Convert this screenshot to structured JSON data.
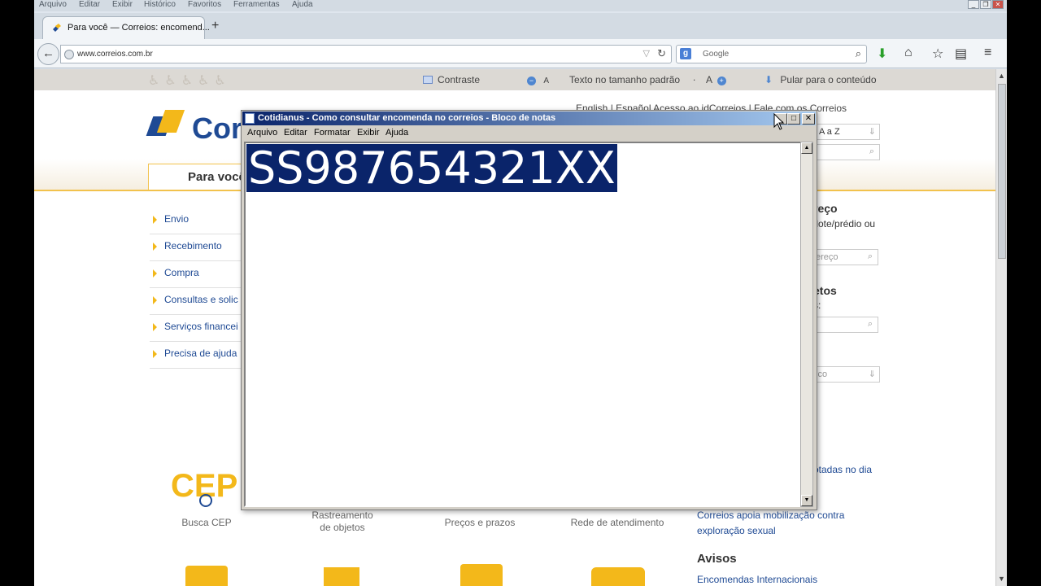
{
  "browser": {
    "menu": [
      "Arquivo",
      "Editar",
      "Exibir",
      "Histórico",
      "Favoritos",
      "Ferramentas",
      "Ajuda"
    ],
    "tab_title": "Para você — Correios: encomend...",
    "new_tab": "+",
    "url": "www.correios.com.br",
    "search_placeholder": "Google",
    "search_engine_letter": "g",
    "back_glyph": "←",
    "icons": [
      "download-icon",
      "home-icon",
      "bookmark-star-icon",
      "reader-icon",
      "menu-icon"
    ]
  },
  "site": {
    "topbar": {
      "contrast": "Contraste",
      "font_minus": "A",
      "font_default": "Texto no tamanho padrão",
      "font_plus": "A",
      "skip": "Pular para o conteúdo"
    },
    "langs": "English  |  Español      Acesso ao idCorreios  |  Fale com os Correios",
    "logo_text": "Cor",
    "tab_active": "Para você",
    "left_menu": [
      "Envio",
      "Recebimento",
      "Compra",
      "Consultas e solic",
      "Serviços financei",
      "Precisa de ajuda"
    ],
    "right": {
      "az": "A a Z",
      "endereco_title": "reço",
      "endereco_text": "/lote/prédio ou",
      "endereco_input": "ereço",
      "objetos_title": "etos",
      "objetos_text": "s:",
      "servico_input": "ico",
      "news1": "otadas no dia",
      "news2": "Correios apoia mobilização contra exploração sexual",
      "avisos_title": "Avisos",
      "avisos_link": "Encomendas Internacionais"
    },
    "bottom": {
      "cep_big": "CEP",
      "busca_cep": "Busca CEP",
      "rastreamento": "Rastreamento\nde objetos",
      "precos": "Preços e prazos",
      "rede": "Rede de atendimento"
    }
  },
  "notepad": {
    "title": "Cotidianus - Como consultar encomenda no correios - Bloco de notas",
    "menu": [
      "Arquivo",
      "Editar",
      "Formatar",
      "Exibir",
      "Ajuda"
    ],
    "content": "SS987654321XX",
    "buttons": {
      "min": "_",
      "max": "□",
      "close": "✕"
    }
  }
}
